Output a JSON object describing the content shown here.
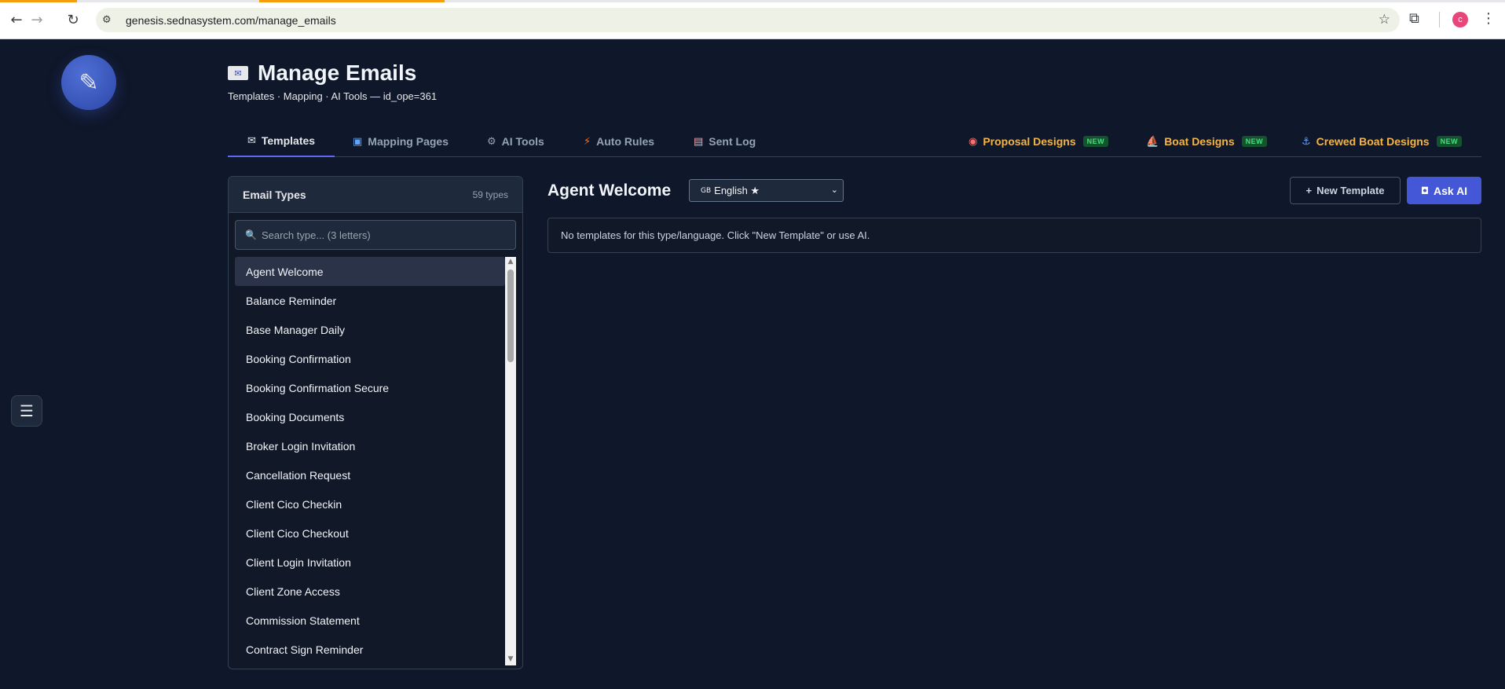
{
  "browser": {
    "url": "genesis.sednasystem.com/manage_emails",
    "back_icon": "←",
    "forward_icon": "→",
    "reload_icon": "↻",
    "site_info_icon": "⚙",
    "star_icon": "☆",
    "extensions_icon": "⧉",
    "profile_initial": "c",
    "menu_icon": "⋮"
  },
  "app": {
    "logo_icon": "✎",
    "hamburger_icon": "☰"
  },
  "header": {
    "title_icon": "✉",
    "title": "Manage Emails",
    "subtitle": "Templates · Mapping · AI Tools — id_ope=361"
  },
  "tabs": [
    {
      "icon": "✉",
      "label": "Templates"
    },
    {
      "icon": "▣",
      "label": "Mapping Pages"
    },
    {
      "icon": "⚙",
      "label": "AI Tools"
    },
    {
      "icon": "⚡",
      "label": "Auto Rules"
    },
    {
      "icon": "▤",
      "label": "Sent Log"
    },
    {
      "icon": "◉",
      "label": "Proposal Designs",
      "badge": "NEW"
    },
    {
      "icon": "⛵",
      "label": "Boat Designs",
      "badge": "NEW"
    },
    {
      "icon": "⚓",
      "label": "Crewed Boat Designs",
      "badge": "NEW"
    }
  ],
  "panel": {
    "title": "Email Types",
    "count": "59 types",
    "search_icon": "🔍",
    "search_placeholder": "Search type... (3 letters)",
    "items": [
      "Agent Welcome",
      "Balance Reminder",
      "Base Manager Daily",
      "Booking Confirmation",
      "Booking Confirmation Secure",
      "Booking Documents",
      "Broker Login Invitation",
      "Cancellation Request",
      "Client Cico Checkin",
      "Client Cico Checkout",
      "Client Login Invitation",
      "Client Zone Access",
      "Commission Statement",
      "Contract Sign Reminder"
    ],
    "selected": "Agent Welcome"
  },
  "main": {
    "title": "Agent Welcome",
    "language_flag": "GB",
    "language_value": "English ★",
    "new_template_label": "New Template",
    "new_template_icon": "+",
    "ask_ai_label": "Ask AI",
    "ask_ai_icon": "◘",
    "empty_message": "No templates for this type/language. Click \"New Template\" or use AI."
  }
}
